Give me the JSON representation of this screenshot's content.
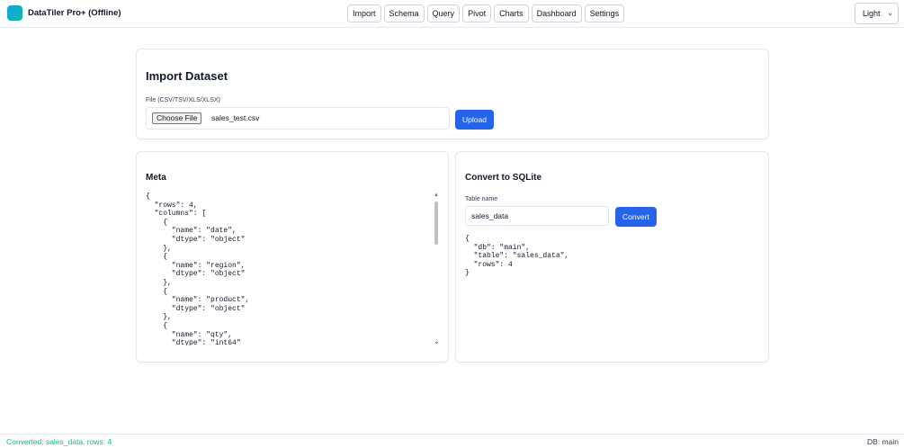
{
  "app": {
    "title": "DataTiler Pro+ (Offline)"
  },
  "nav": [
    "Import",
    "Schema",
    "Query",
    "Pivot",
    "Charts",
    "Dashboard",
    "Settings"
  ],
  "theme": {
    "selected": "Light"
  },
  "import_panel": {
    "title": "Import Dataset",
    "file_label": "File (CSV/TSV/XLS/XLSX)",
    "choose_label": "Choose File",
    "file_name": "sales_test.csv",
    "upload_label": "Upload"
  },
  "meta_panel": {
    "title": "Meta",
    "json_text": "{\n  \"rows\": 4,\n  \"columns\": [\n    {\n      \"name\": \"date\",\n      \"dtype\": \"object\"\n    },\n    {\n      \"name\": \"region\",\n      \"dtype\": \"object\"\n    },\n    {\n      \"name\": \"product\",\n      \"dtype\": \"object\"\n    },\n    {\n      \"name\": \"qty\",\n      \"dtype\": \"int64\"\n    },"
  },
  "sqlite_panel": {
    "title": "Convert to SQLite",
    "table_label": "Table name",
    "table_value": "sales_data",
    "convert_label": "Convert",
    "json_text": "{\n  \"db\": \"main\",\n  \"table\": \"sales_data\",\n  \"rows\": 4\n}"
  },
  "status": {
    "message": "Converted: sales_data, rows: 4",
    "db": "DB: main"
  },
  "colors": {
    "accent": "#2563eb",
    "status_ok": "#10b981",
    "logo_start": "#0ea5e9",
    "logo_end": "#14b8a6"
  }
}
